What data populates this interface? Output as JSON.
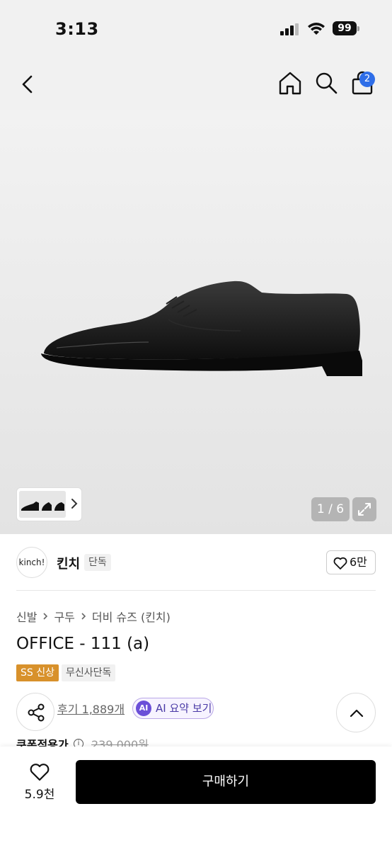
{
  "status_bar": {
    "time": "3:13",
    "battery": "99",
    "icons": [
      "signal-icon",
      "wifi-icon",
      "battery-icon"
    ]
  },
  "header": {
    "icons": [
      "back-icon",
      "home-icon",
      "search-icon",
      "shopping-bag-icon"
    ],
    "cart_count": "2"
  },
  "gallery": {
    "counter": "1 / 6",
    "icons": [
      "chevron-right-icon",
      "expand-icon"
    ]
  },
  "brand": {
    "logo_text": "kinch!",
    "name": "킨치",
    "badge": "단독",
    "like_count": "6만"
  },
  "breadcrumb": [
    "신발",
    "구두",
    "더비 슈즈 (킨치)"
  ],
  "product": {
    "title": "OFFICE - 111 (a)",
    "tags": [
      "SS 신상",
      "무신사단독"
    ],
    "review_link": "후기 1,889개",
    "ai_icon": "AI",
    "ai_button": "AI 요약 보기",
    "price_label": "쿠폰적용가",
    "info_icon": "i",
    "original_price": "239,000원"
  },
  "bottom_bar": {
    "favorite_count": "5.9천",
    "buy_label": "구매하기"
  },
  "colors": {
    "accent_blue": "#2f6ee8",
    "ss_tag": "#d8912b",
    "ai_purple": "#6b4fd8",
    "buy_button": "#000000"
  }
}
